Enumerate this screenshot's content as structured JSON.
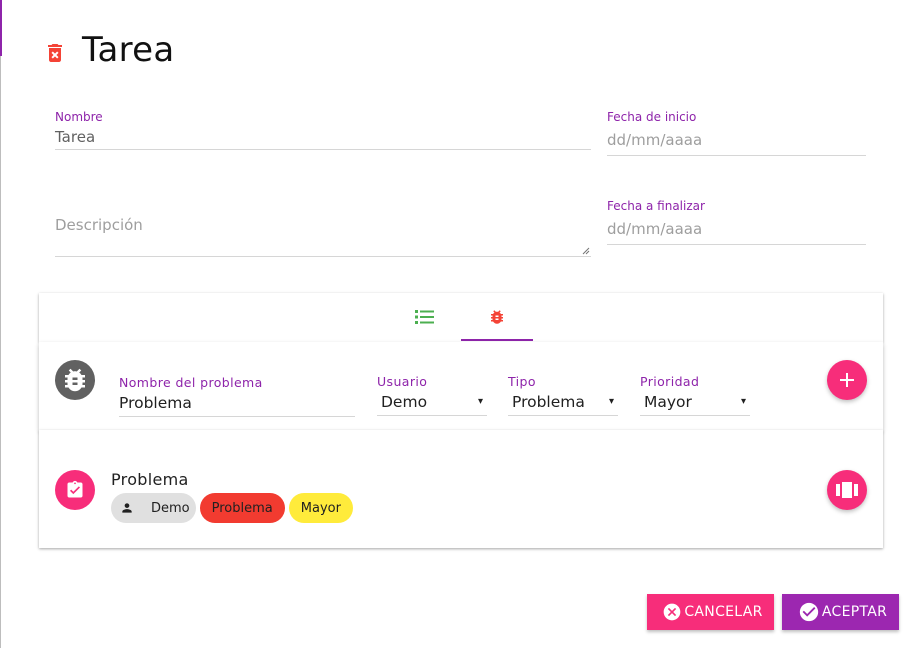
{
  "header": {
    "title": "Tarea",
    "delete_icon": "trash-icon"
  },
  "fields": {
    "nombre": {
      "label": "Nombre",
      "value": "Tarea"
    },
    "descripcion": {
      "placeholder": "Descripción"
    },
    "fecha_inicio": {
      "label": "Fecha de inicio",
      "placeholder": "dd/mm/aaaa"
    },
    "fecha_fin": {
      "label": "Fecha a finalizar",
      "placeholder": "dd/mm/aaaa"
    }
  },
  "tabs": [
    {
      "icon": "list-icon",
      "color": "#4caf50",
      "active": false
    },
    {
      "icon": "bug-icon",
      "color": "#f44336",
      "active": true
    }
  ],
  "problem_form": {
    "nombre": {
      "label": "Nombre del problema",
      "value": "Problema"
    },
    "usuario": {
      "label": "Usuario",
      "value": "Demo"
    },
    "tipo": {
      "label": "Tipo",
      "value": "Problema"
    },
    "prioridad": {
      "label": "Prioridad",
      "value": "Mayor"
    },
    "arrow": "▾"
  },
  "problems": [
    {
      "title": "Problema",
      "user": "Demo",
      "type": "Problema",
      "priority": "Mayor"
    }
  ],
  "actions": {
    "cancel": "CANCELAR",
    "accept": "ACEPTAR"
  },
  "colors": {
    "accent": "#8e24aa",
    "pink": "#f72d7a",
    "purple": "#9c27b0",
    "red": "#f23b30",
    "yellow": "#ffeb3b"
  }
}
